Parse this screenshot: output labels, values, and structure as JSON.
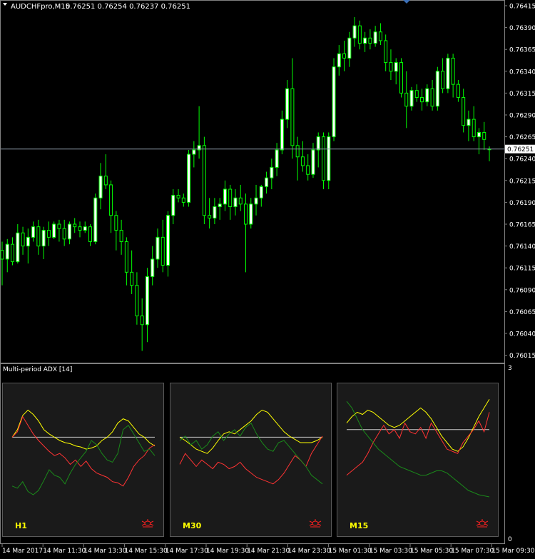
{
  "chart_data": [
    {
      "type": "candlestick",
      "title": "AUDCHFpro,M15",
      "ohlc_readout": "0.76251 0.76254 0.76237 0.76251",
      "ylim": [
        0.76005,
        0.7642
      ],
      "y_ticks": [
        "0.76415",
        "0.76390",
        "0.76365",
        "0.76340",
        "0.76315",
        "0.76290",
        "0.76265",
        "0.76240",
        "0.76215",
        "0.76190",
        "0.76165",
        "0.76140",
        "0.76115",
        "0.76090",
        "0.76065",
        "0.76040",
        "0.76015"
      ],
      "current_price": "0.76251",
      "current_price_value": 0.76251,
      "x_ticks": [
        "14 Mar 2017",
        "14 Mar 11:30",
        "14 Mar 13:30",
        "14 Mar 15:30",
        "14 Mar 17:30",
        "14 Mar 19:30",
        "14 Mar 21:30",
        "14 Mar 23:30",
        "15 Mar 01:30",
        "15 Mar 03:30",
        "15 Mar 05:30",
        "15 Mar 07:30",
        "15 Mar 09:30"
      ],
      "candles": [
        [
          0.76135,
          0.76145,
          0.76095,
          0.76125
        ],
        [
          0.76125,
          0.76148,
          0.7611,
          0.76142
        ],
        [
          0.76142,
          0.7615,
          0.76118,
          0.76122
        ],
        [
          0.76122,
          0.76165,
          0.7612,
          0.76155
        ],
        [
          0.76155,
          0.76162,
          0.7613,
          0.7614
        ],
        [
          0.7614,
          0.7616,
          0.7612,
          0.7615
        ],
        [
          0.7615,
          0.76168,
          0.76145,
          0.76162
        ],
        [
          0.76162,
          0.7617,
          0.7613,
          0.7614
        ],
        [
          0.7614,
          0.76162,
          0.76125,
          0.76158
        ],
        [
          0.76158,
          0.76168,
          0.7614,
          0.7615
        ],
        [
          0.7615,
          0.76168,
          0.76148,
          0.76165
        ],
        [
          0.76165,
          0.7617,
          0.76145,
          0.7616
        ],
        [
          0.7616,
          0.7617,
          0.7614,
          0.76148
        ],
        [
          0.76148,
          0.76168,
          0.76142,
          0.76165
        ],
        [
          0.76165,
          0.76172,
          0.76155,
          0.76162
        ],
        [
          0.76162,
          0.76168,
          0.7615,
          0.76158
        ],
        [
          0.76158,
          0.76168,
          0.76155,
          0.76162
        ],
        [
          0.76162,
          0.76165,
          0.7614,
          0.76145
        ],
        [
          0.76145,
          0.762,
          0.76142,
          0.76195
        ],
        [
          0.76195,
          0.76235,
          0.76182,
          0.7622
        ],
        [
          0.7622,
          0.76245,
          0.76205,
          0.7621
        ],
        [
          0.7621,
          0.76215,
          0.76155,
          0.76175
        ],
        [
          0.76175,
          0.7618,
          0.76135,
          0.76158
        ],
        [
          0.76158,
          0.7617,
          0.7613,
          0.76145
        ],
        [
          0.76145,
          0.7615,
          0.76095,
          0.7611
        ],
        [
          0.7611,
          0.76135,
          0.76085,
          0.76095
        ],
        [
          0.76095,
          0.7611,
          0.7605,
          0.7606
        ],
        [
          0.7606,
          0.7608,
          0.7602,
          0.7605
        ],
        [
          0.7605,
          0.76115,
          0.7603,
          0.76105
        ],
        [
          0.76105,
          0.7614,
          0.76095,
          0.76125
        ],
        [
          0.76125,
          0.7616,
          0.76115,
          0.7615
        ],
        [
          0.7615,
          0.7617,
          0.7611,
          0.76118
        ],
        [
          0.76118,
          0.7618,
          0.76105,
          0.76175
        ],
        [
          0.76175,
          0.76205,
          0.76165,
          0.76198
        ],
        [
          0.76198,
          0.76205,
          0.7619,
          0.76195
        ],
        [
          0.76195,
          0.762,
          0.76185,
          0.7619
        ],
        [
          0.7619,
          0.7625,
          0.76185,
          0.76245
        ],
        [
          0.76245,
          0.7626,
          0.7623,
          0.7625
        ],
        [
          0.7625,
          0.763,
          0.7624,
          0.76255
        ],
        [
          0.76255,
          0.76265,
          0.76165,
          0.76175
        ],
        [
          0.76175,
          0.76195,
          0.7616,
          0.76172
        ],
        [
          0.76172,
          0.76195,
          0.76165,
          0.76185
        ],
        [
          0.76185,
          0.76195,
          0.7617,
          0.76188
        ],
        [
          0.76188,
          0.76215,
          0.7618,
          0.76205
        ],
        [
          0.76205,
          0.7621,
          0.7617,
          0.76185
        ],
        [
          0.76185,
          0.76205,
          0.76175,
          0.76195
        ],
        [
          0.76195,
          0.7621,
          0.7618,
          0.76188
        ],
        [
          0.76188,
          0.762,
          0.7611,
          0.76165
        ],
        [
          0.76165,
          0.76195,
          0.7616,
          0.76188
        ],
        [
          0.76188,
          0.7621,
          0.76175,
          0.76195
        ],
        [
          0.76195,
          0.7621,
          0.76185,
          0.76208
        ],
        [
          0.76208,
          0.76225,
          0.762,
          0.76218
        ],
        [
          0.76218,
          0.7624,
          0.76205,
          0.7623
        ],
        [
          0.7623,
          0.76258,
          0.7622,
          0.7625
        ],
        [
          0.7625,
          0.76295,
          0.76245,
          0.76285
        ],
        [
          0.76285,
          0.7633,
          0.76275,
          0.7632
        ],
        [
          0.7632,
          0.76355,
          0.7624,
          0.76255
        ],
        [
          0.76255,
          0.76265,
          0.76215,
          0.76242
        ],
        [
          0.76242,
          0.7626,
          0.76225,
          0.76232
        ],
        [
          0.76232,
          0.76245,
          0.76215,
          0.76222
        ],
        [
          0.76222,
          0.76258,
          0.76218,
          0.7625
        ],
        [
          0.7625,
          0.7627,
          0.7623,
          0.76265
        ],
        [
          0.76265,
          0.7627,
          0.76205,
          0.76215
        ],
        [
          0.76215,
          0.7627,
          0.76205,
          0.76265
        ],
        [
          0.76265,
          0.76355,
          0.7626,
          0.76345
        ],
        [
          0.76345,
          0.7637,
          0.76335,
          0.7636
        ],
        [
          0.7636,
          0.76375,
          0.7634,
          0.76355
        ],
        [
          0.76355,
          0.76385,
          0.76345,
          0.76378
        ],
        [
          0.76378,
          0.76402,
          0.76368,
          0.76392
        ],
        [
          0.76392,
          0.76398,
          0.76365,
          0.76372
        ],
        [
          0.76372,
          0.76385,
          0.76362,
          0.76378
        ],
        [
          0.76378,
          0.76388,
          0.76365,
          0.76372
        ],
        [
          0.76372,
          0.76392,
          0.76368,
          0.76385
        ],
        [
          0.76385,
          0.76395,
          0.7637,
          0.76375
        ],
        [
          0.76375,
          0.76382,
          0.7634,
          0.7635
        ],
        [
          0.7635,
          0.76365,
          0.7633,
          0.7634
        ],
        [
          0.7634,
          0.76355,
          0.76325,
          0.7635
        ],
        [
          0.7635,
          0.76355,
          0.7631,
          0.76315
        ],
        [
          0.76315,
          0.7634,
          0.76275,
          0.763
        ],
        [
          0.763,
          0.76322,
          0.76295,
          0.76318
        ],
        [
          0.76318,
          0.76325,
          0.76305,
          0.7631
        ],
        [
          0.7631,
          0.7632,
          0.76295,
          0.76305
        ],
        [
          0.76305,
          0.76325,
          0.763,
          0.7632
        ],
        [
          0.7632,
          0.7633,
          0.76295,
          0.763
        ],
        [
          0.763,
          0.76345,
          0.76295,
          0.7634
        ],
        [
          0.7634,
          0.76355,
          0.76315,
          0.7632
        ],
        [
          0.7632,
          0.7636,
          0.76315,
          0.76355
        ],
        [
          0.76355,
          0.7636,
          0.7631,
          0.76325
        ],
        [
          0.76325,
          0.7633,
          0.76305,
          0.7631
        ],
        [
          0.7631,
          0.7632,
          0.7627,
          0.76278
        ],
        [
          0.76278,
          0.76295,
          0.7626,
          0.76285
        ],
        [
          0.76285,
          0.763,
          0.7626,
          0.76265
        ],
        [
          0.76265,
          0.76275,
          0.76245,
          0.7627
        ],
        [
          0.7627,
          0.76282,
          0.7625,
          0.76262
        ],
        [
          0.76251,
          0.76254,
          0.76237,
          0.76251
        ]
      ]
    },
    {
      "type": "line",
      "title": "Multi-period ADX [14]",
      "y_ticks": [
        "3",
        "0"
      ],
      "panels": [
        {
          "label": "H1",
          "icon": "bug-icon",
          "baseline": 0.55,
          "series": [
            {
              "color": "#ffff00",
              "values": [
                0.55,
                0.62,
                0.75,
                0.8,
                0.76,
                0.7,
                0.62,
                0.58,
                0.55,
                0.52,
                0.5,
                0.49,
                0.47,
                0.46,
                0.44,
                0.45,
                0.47,
                0.52,
                0.55,
                0.6,
                0.68,
                0.72,
                0.7,
                0.64,
                0.58,
                0.55,
                0.5,
                0.47
              ]
            },
            {
              "color": "#ff3333",
              "values": [
                0.55,
                0.6,
                0.74,
                0.66,
                0.58,
                0.52,
                0.47,
                0.42,
                0.38,
                0.4,
                0.36,
                0.3,
                0.34,
                0.28,
                0.33,
                0.26,
                0.22,
                0.2,
                0.18,
                0.14,
                0.13,
                0.1,
                0.18,
                0.28,
                0.34,
                0.38,
                0.45,
                0.48
              ]
            },
            {
              "color": "#1a8a1a",
              "values": [
                0.1,
                0.08,
                0.14,
                0.05,
                0.02,
                0.06,
                0.15,
                0.25,
                0.2,
                0.18,
                0.12,
                0.22,
                0.3,
                0.36,
                0.42,
                0.52,
                0.48,
                0.4,
                0.34,
                0.32,
                0.4,
                0.62,
                0.66,
                0.58,
                0.5,
                0.42,
                0.44,
                0.38
              ]
            }
          ]
        },
        {
          "label": "M30",
          "icon": "bug-icon",
          "baseline": 0.55,
          "series": [
            {
              "color": "#ffff00",
              "values": [
                0.55,
                0.52,
                0.48,
                0.44,
                0.42,
                0.4,
                0.45,
                0.52,
                0.58,
                0.6,
                0.58,
                0.62,
                0.66,
                0.7,
                0.76,
                0.8,
                0.78,
                0.72,
                0.66,
                0.6,
                0.56,
                0.53,
                0.5,
                0.5,
                0.5,
                0.52,
                0.55
              ]
            },
            {
              "color": "#ff3333",
              "values": [
                0.3,
                0.4,
                0.34,
                0.28,
                0.34,
                0.3,
                0.26,
                0.32,
                0.3,
                0.26,
                0.28,
                0.32,
                0.26,
                0.22,
                0.18,
                0.16,
                0.14,
                0.12,
                0.16,
                0.22,
                0.3,
                0.38,
                0.34,
                0.28,
                0.4,
                0.48,
                0.56
              ]
            },
            {
              "color": "#1a8a1a",
              "values": [
                0.52,
                0.56,
                0.48,
                0.52,
                0.44,
                0.48,
                0.56,
                0.6,
                0.52,
                0.58,
                0.62,
                0.56,
                0.64,
                0.68,
                0.58,
                0.5,
                0.44,
                0.42,
                0.5,
                0.52,
                0.46,
                0.4,
                0.34,
                0.28,
                0.2,
                0.16,
                0.12
              ]
            }
          ]
        },
        {
          "label": "M15",
          "icon": "bug-icon",
          "baseline": 0.62,
          "series": [
            {
              "color": "#ffff00",
              "values": [
                0.68,
                0.74,
                0.78,
                0.76,
                0.8,
                0.78,
                0.74,
                0.7,
                0.66,
                0.64,
                0.66,
                0.7,
                0.74,
                0.78,
                0.82,
                0.78,
                0.72,
                0.64,
                0.56,
                0.5,
                0.44,
                0.42,
                0.46,
                0.54,
                0.64,
                0.74,
                0.82,
                0.9
              ]
            },
            {
              "color": "#ff3333",
              "values": [
                0.2,
                0.24,
                0.28,
                0.32,
                0.4,
                0.5,
                0.58,
                0.66,
                0.58,
                0.62,
                0.54,
                0.68,
                0.6,
                0.58,
                0.64,
                0.54,
                0.68,
                0.6,
                0.52,
                0.44,
                0.42,
                0.4,
                0.5,
                0.56,
                0.62,
                0.7,
                0.6,
                0.78
              ]
            },
            {
              "color": "#1a8a1a",
              "values": [
                0.88,
                0.82,
                0.72,
                0.62,
                0.56,
                0.5,
                0.44,
                0.4,
                0.36,
                0.32,
                0.28,
                0.26,
                0.24,
                0.22,
                0.2,
                0.2,
                0.22,
                0.24,
                0.24,
                0.22,
                0.18,
                0.14,
                0.1,
                0.06,
                0.04,
                0.02,
                0.01,
                0.0
              ]
            }
          ]
        }
      ]
    }
  ],
  "colors": {
    "bull_candle": "#ffffff",
    "bear_candle": "#000000",
    "wick": "#00ff00",
    "price_line": "#8c9aa8",
    "grid": "#808080",
    "text": "#ffffff",
    "panel_bg": "#1a1a1a"
  }
}
